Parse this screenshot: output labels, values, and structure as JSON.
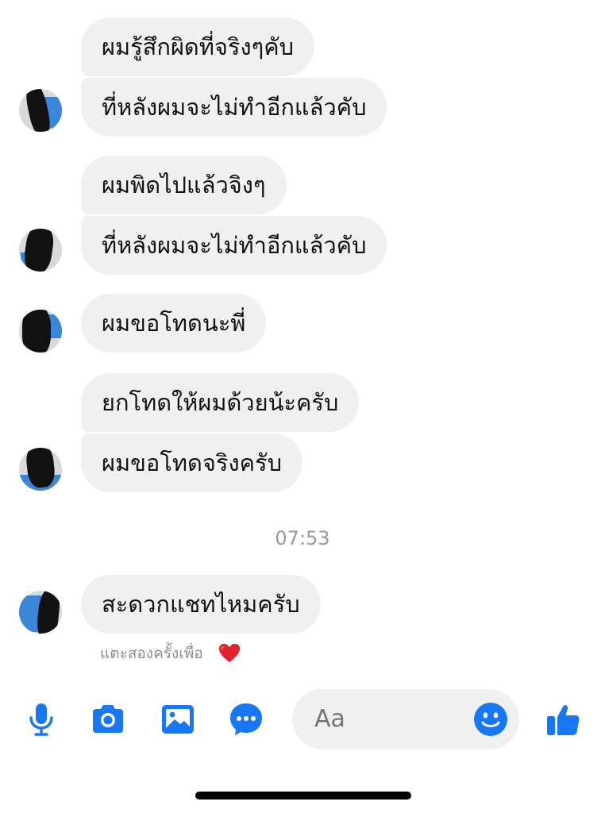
{
  "messages": [
    {
      "text": "ผมรู้สึกผิดที่จริงๆคับ"
    },
    {
      "text": "ที่หลังผมจะไม่ทำอีกแล้วคับ"
    },
    {
      "text": "ผมพิดไปแล้วจิงๆ"
    },
    {
      "text": "ที่หลังผมจะไม่ทำอีกแล้วคับ"
    },
    {
      "text": "ผมขอโทดนะพี่"
    },
    {
      "text": "ยกโทดให้ผมด้วยน้ะครับ"
    },
    {
      "text": "ผมขอโทดจริงครับ"
    },
    {
      "text": "สะดวกแชทไหมครับ"
    }
  ],
  "timestamp": "07:53",
  "hint": {
    "text": "แตะสองครั้งเพื่อ",
    "icon": "heart-icon",
    "color": "#e0242f"
  },
  "composer": {
    "placeholder": "Aa",
    "tools": [
      "microphone-icon",
      "camera-icon",
      "image-icon",
      "chat-bubble-icon"
    ],
    "emoji_icon": "smiley-icon",
    "send_icon": "thumbs-up-icon",
    "accent": "#1877f2"
  }
}
